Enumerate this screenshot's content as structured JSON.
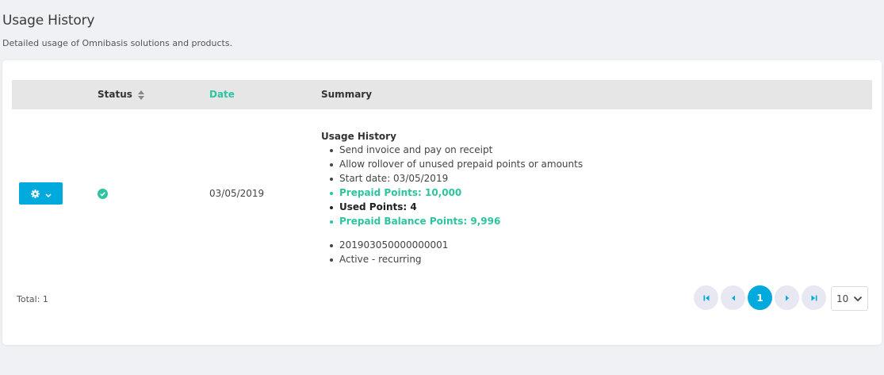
{
  "header": {
    "title": "Usage History",
    "subtitle": "Detailed usage of Omnibasis solutions and products."
  },
  "table": {
    "columns": {
      "status": "Status",
      "date": "Date",
      "summary": "Summary"
    },
    "rows": [
      {
        "status": "active",
        "date": "03/05/2019",
        "summary": {
          "title": "Usage History",
          "items": [
            "Send invoice and pay on receipt",
            "Allow rollover of unused prepaid points or amounts",
            "Start date: 03/05/2019",
            "Prepaid Points: 10,000",
            "Used Points: 4",
            "Prepaid Balance Points: 9,996"
          ],
          "extra_items": [
            "201903050000000001",
            "Active - recurring"
          ]
        }
      }
    ]
  },
  "footer": {
    "total": "Total: 1"
  },
  "pagination": {
    "current_page": "1",
    "page_size": "10"
  },
  "colors": {
    "accent": "#00aadd",
    "success": "#2ec4a0"
  }
}
